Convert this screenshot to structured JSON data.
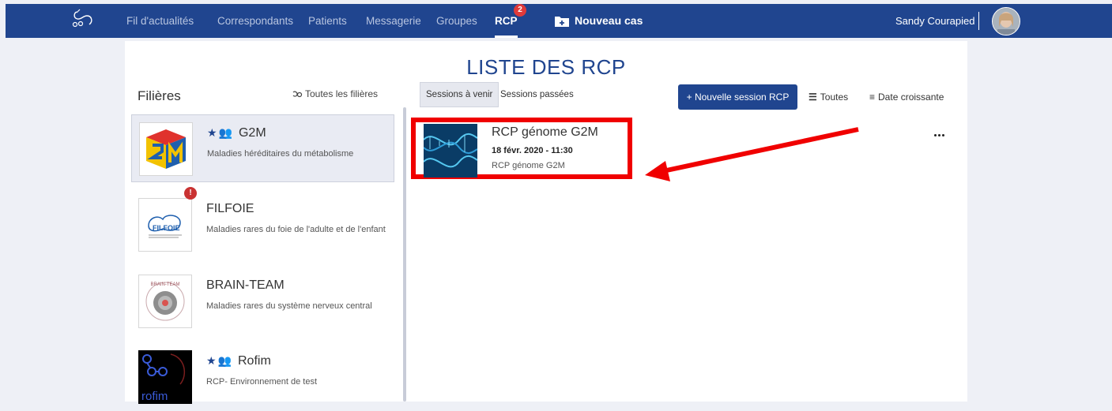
{
  "navbar": {
    "items": [
      {
        "label": "Fil d'actualités"
      },
      {
        "label": "Correspondants"
      },
      {
        "label": "Patients"
      },
      {
        "label": "Messagerie"
      },
      {
        "label": "Groupes"
      },
      {
        "label": "RCP",
        "badge": "2"
      }
    ],
    "new_case_label": "Nouveau cas",
    "user_name": "Sandy Courapied"
  },
  "page": {
    "title": "LISTE DES RCP"
  },
  "filieres": {
    "title": "Filières",
    "all_link": "Toutes les filières",
    "items": [
      {
        "name": "G2M",
        "description": "Maladies héréditaires du métabolisme"
      },
      {
        "name": "FILFOIE",
        "description": "Maladies rares du foie de l'adulte et de l'enfant",
        "alert": "!"
      },
      {
        "name": "BRAIN-TEAM",
        "description": "Maladies rares du système nerveux central"
      },
      {
        "name": "Rofim",
        "description": "RCP- Environnement de test"
      }
    ],
    "logo_texts": {
      "filfoie": "FILFOIE",
      "rofim": "rofim",
      "brain": "BRAIN-TEAM"
    }
  },
  "sessions": {
    "tab_upcoming": "Sessions à venir",
    "tab_past": "Sessions passées",
    "new_session_label": "+ Nouvelle session RCP",
    "filter_all": "Toutes",
    "sort_label": "Date croissante",
    "list": [
      {
        "title": "RCP génome G2M",
        "date": "18 févr. 2020 - 11:30",
        "subtitle": "RCP génome G2M"
      }
    ]
  },
  "colors": {
    "brand": "#20458f",
    "highlight": "#f00000",
    "badge": "#e03a3a"
  }
}
